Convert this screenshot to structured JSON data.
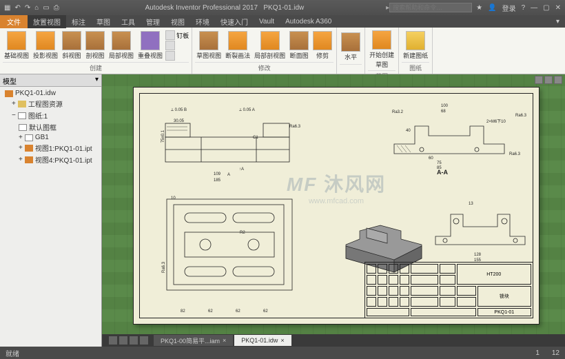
{
  "titlebar": {
    "app": "Autodesk Inventor Professional 2017",
    "doc": "PKQ1-01.idw",
    "search_ph": "搜索帮助和命令…",
    "login": "登录"
  },
  "menubar": {
    "file": "文件",
    "active": "放置视图",
    "items": [
      "标注",
      "草图",
      "工具",
      "管理",
      "视图",
      "环境",
      "快速入门",
      "Vault",
      "Autodesk A360"
    ]
  },
  "ribbon": {
    "g1": {
      "label": "创建",
      "b1": "基础视图",
      "b2": "投影视图",
      "b3": "斜视图",
      "b4": "剖视图",
      "b5": "局部视图",
      "b6": "重叠视图",
      "nail": "钉板"
    },
    "g2": {
      "label": "修改",
      "b1": "草图视图",
      "b2": "断裂画法",
      "b3": "局部剖视图",
      "b4": "断面图",
      "b5": "修剪"
    },
    "g3": {
      "b1": "水平"
    },
    "g4": {
      "label": "草图",
      "b1": "开始创建",
      "b2": "草图"
    },
    "g5": {
      "label": "图纸",
      "b1": "新建图纸"
    }
  },
  "browser": {
    "title": "模型",
    "root": "PKQ1-01.idw",
    "items": [
      "工程图资源",
      "图纸:1",
      "默认图框",
      "GB1",
      "视图1:PKQ1-01.ipt",
      "视图4:PKQ1-01.ipt"
    ]
  },
  "tabs": {
    "t1": "PKQ1-00简易平...iam",
    "t2": "PKQ1-01.idw"
  },
  "drawing": {
    "watermark": "沐风网",
    "watermark_sub": "www.mfcad.com",
    "watermark_logo": "MF",
    "section_label": "A-A",
    "title_material": "HT200",
    "title_name": "锁块",
    "title_no": "PKQ1-01",
    "dims": {
      "d185": "185",
      "d109": "109",
      "d30": "30.05",
      "d82a": "82",
      "d62a": "62",
      "d62b": "62",
      "d62c": "62",
      "d10": "10",
      "dA": "A",
      "dAl": "A",
      "d100": "100",
      "d68": "68",
      "d60": "60",
      "d75": "75",
      "d85": "85",
      "d155": "155",
      "d128": "128",
      "d13": "13",
      "d40": "40",
      "ra63a": "Ra6.3",
      "ra63b": "Ra6.3",
      "ra63c": "Ra6.3",
      "ra63d": "Ra6.3",
      "ra32": "Ra3.2",
      "thread": "2×M6下10",
      "t005a": "0.05",
      "t005b": "0.05",
      "tA": "A",
      "c1": "C1",
      "r2": "R2"
    }
  },
  "status": {
    "left": "就绪",
    "n1": "1",
    "n2": "12"
  }
}
